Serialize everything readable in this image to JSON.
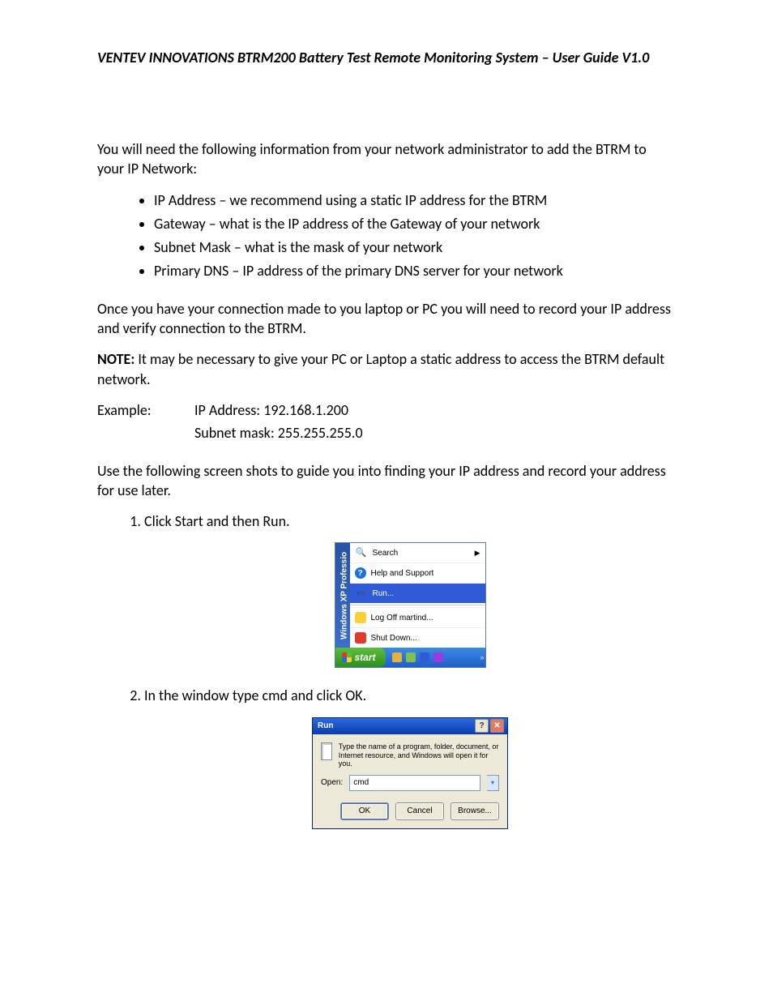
{
  "header": "VENTEV INNOVATIONS BTRM200 Battery Test Remote Monitoring System – User Guide V1.0",
  "intro": "You will need the following information from your network administrator to add the BTRM to your IP Network:",
  "bullets": [
    "IP Address – we recommend using a static IP address for the BTRM",
    "Gateway – what is the IP address of the Gateway of your network",
    "Subnet Mask – what is the mask of your network",
    "Primary DNS – IP address of the primary DNS server for your network"
  ],
  "para2": "Once you have your connection made to you laptop or PC you will need to record your IP address and verify connection to the BTRM.",
  "note_label": "NOTE:",
  "note_text": " It may be necessary to give your PC or Laptop a static address to access the BTRM default network.",
  "example_label": "Example:",
  "example_ip": "IP Address: 192.168.1.200",
  "example_mask": "Subnet mask: 255.255.255.0",
  "para3": "Use the following screen shots to guide you into finding your IP address and record your address for use later.",
  "steps": [
    "Click Start and then Run.",
    "In the window type cmd and click OK."
  ],
  "start_menu": {
    "sidebar_text": "Windows XP Professio",
    "items": {
      "search": "Search",
      "help": "Help and Support",
      "run": "Run...",
      "logoff": "Log Off martind...",
      "shutdown": "Shut Down..."
    },
    "taskbar_label": "start"
  },
  "run_dialog": {
    "title": "Run",
    "desc": "Type the name of a program, folder, document, or Internet resource, and Windows will open it for you.",
    "open_label": "Open:",
    "open_value": "cmd",
    "buttons": {
      "ok": "OK",
      "cancel": "Cancel",
      "browse": "Browse..."
    }
  }
}
